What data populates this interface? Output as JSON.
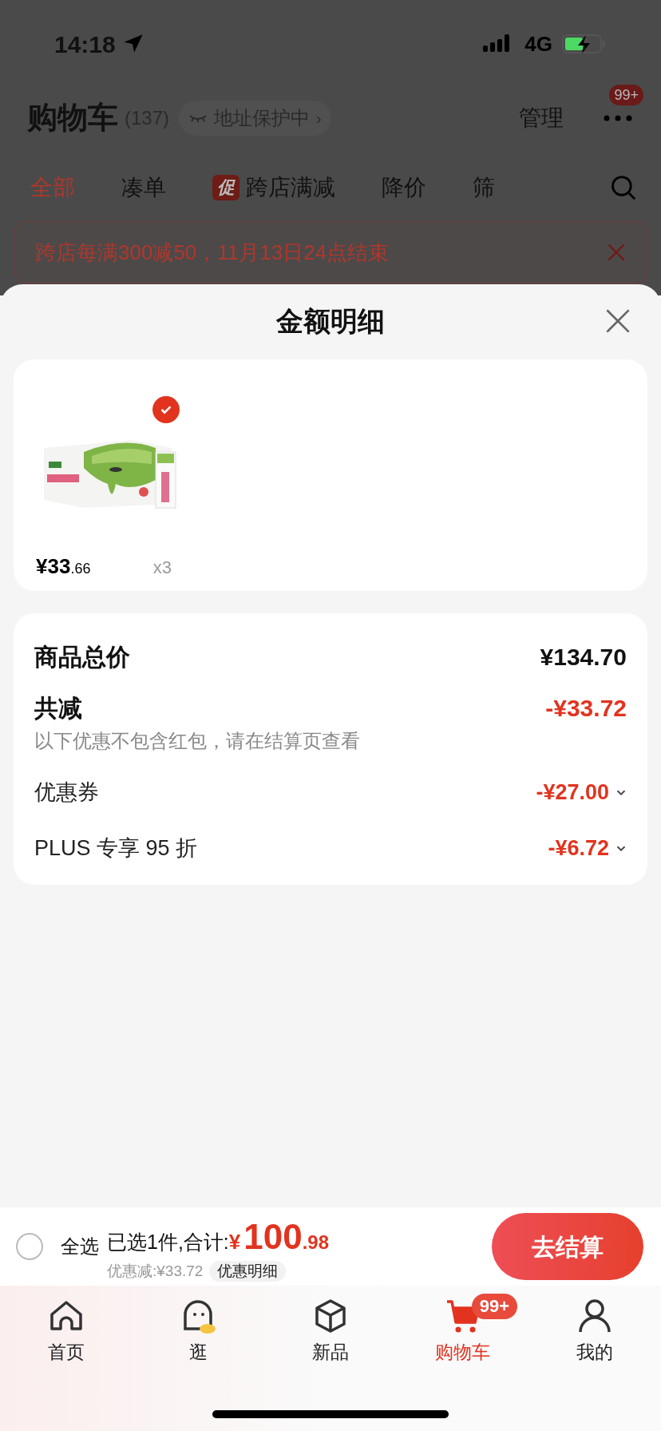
{
  "status_bar": {
    "time": "14:18",
    "network": "4G"
  },
  "header": {
    "title": "购物车",
    "count": "(137)",
    "address_chip": "地址保护中",
    "address_chip_chevron": "›",
    "manage": "管理",
    "more_badge": "99+"
  },
  "tabs": [
    {
      "label": "全部",
      "selected": true
    },
    {
      "label": "凑单",
      "selected": false
    },
    {
      "label": "跨店满减",
      "selected": false,
      "tag": "促"
    },
    {
      "label": "降价",
      "selected": false
    },
    {
      "label": "筛",
      "selected": false
    }
  ],
  "promo_banner": {
    "text": "跨店每满300减50，11月13日24点结束"
  },
  "sheet": {
    "title": "金额明细",
    "products": [
      {
        "kind": "picture",
        "checked": true,
        "price_main": "¥33",
        "price_decimal": ".66",
        "quantity": "x3"
      }
    ],
    "summary": {
      "total_label": "商品总价",
      "total_value": "¥134.70",
      "reduction_label": "共减",
      "reduction_value": "-¥33.72",
      "note": "以下优惠不包含红包，请在结算页查看",
      "discounts": [
        {
          "label": "优惠券",
          "value": "-¥27.00"
        },
        {
          "label": "PLUS 专享 95 折",
          "value": "-¥6.72"
        }
      ]
    }
  },
  "checkout_bar": {
    "select_all": {
      "label": "全选",
      "checked": false
    },
    "selected_text": "已选1件,合计:",
    "total_currency": "¥",
    "total_main": "100",
    "total_decimal": ".98",
    "discount_text": "优惠减:¥33.72",
    "detail_button": "优惠明细",
    "checkout_button": "去结算"
  },
  "tab_bar": [
    {
      "kind": "home",
      "label": "首页",
      "selected": false
    },
    {
      "kind": "face",
      "label": "逛",
      "selected": false
    },
    {
      "kind": "cube",
      "label": "新品",
      "selected": false
    },
    {
      "kind": "cart",
      "label": "购物车",
      "selected": true,
      "badge": "99+"
    },
    {
      "kind": "person",
      "label": "我的",
      "selected": false
    }
  ]
}
